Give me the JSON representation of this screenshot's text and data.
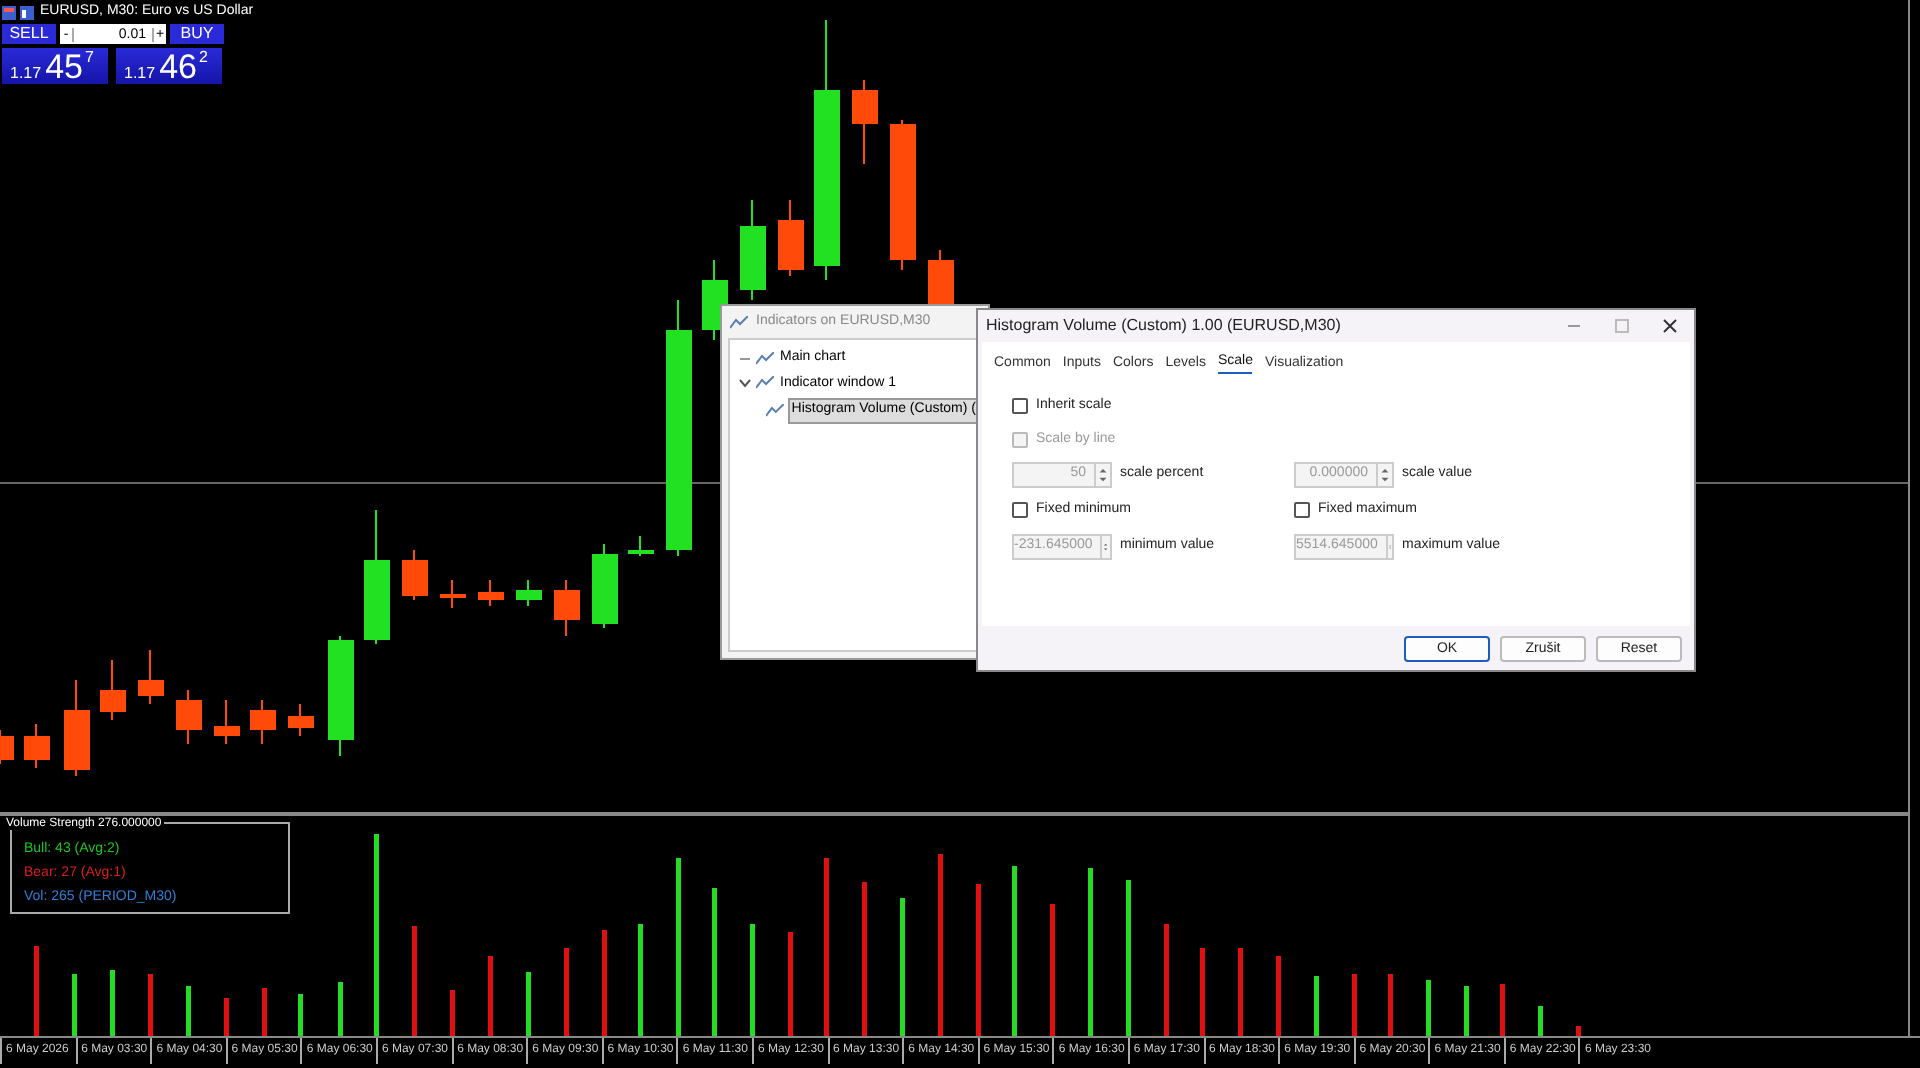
{
  "chart_title": "EURUSD, M30:  Euro vs US Dollar",
  "trade_panel": {
    "sell": "SELL",
    "buy": "BUY",
    "lot": "0.01",
    "minus": "-",
    "plus": "+",
    "bid": {
      "prefix": "1.17",
      "pips": "45",
      "point": "7"
    },
    "ask": {
      "prefix": "1.17",
      "pips": "46",
      "point": "2"
    }
  },
  "indicator_box": {
    "title": "Volume Strength 276.000000",
    "lines": [
      {
        "text": "Bull: 43 (Avg:2)",
        "color": "#19c819"
      },
      {
        "text": "Bear: 27 (Avg:1)",
        "color": "#d81e1e"
      },
      {
        "text": "Vol: 265 (PERIOD_M30)",
        "color": "#2f7fd8"
      }
    ]
  },
  "time_axis": [
    "6 May 2026",
    "6 May 03:30",
    "6 May 04:30",
    "6 May 05:30",
    "6 May 06:30",
    "6 May 07:30",
    "6 May 08:30",
    "6 May 09:30",
    "6 May 10:30",
    "6 May 11:30",
    "6 May 12:30",
    "6 May 13:30",
    "6 May 14:30",
    "6 May 15:30",
    "6 May 16:30",
    "6 May 17:30",
    "6 May 18:30",
    "6 May 19:30",
    "6 May 20:30",
    "6 May 21:30",
    "6 May 22:30",
    "6 May 23:30"
  ],
  "indicators_window": {
    "title": "Indicators on EURUSD,M30",
    "tree": [
      {
        "label": "Main chart",
        "selected": false,
        "expanded": false
      },
      {
        "label": "Indicator window 1",
        "selected": false,
        "expanded": true,
        "children": [
          {
            "label": "Histogram Volume (Custom) (",
            "selected": true
          }
        ]
      }
    ]
  },
  "dialog": {
    "title": "Histogram Volume (Custom) 1.00 (EURUSD,M30)",
    "tabs": [
      {
        "label": "Common",
        "selected": false
      },
      {
        "label": "Inputs",
        "selected": false
      },
      {
        "label": "Colors",
        "selected": false
      },
      {
        "label": "Levels",
        "selected": false
      },
      {
        "label": "Scale",
        "selected": true
      },
      {
        "label": "Visualization",
        "selected": false
      }
    ],
    "inherit_scale": {
      "label": "Inherit scale",
      "checked": false,
      "disabled": false
    },
    "scale_by_line": {
      "label": "Scale by line",
      "checked": false,
      "disabled": true
    },
    "scale_percent": {
      "value": "50",
      "label": "scale percent",
      "disabled": true
    },
    "scale_value": {
      "value": "0.000000",
      "label": "scale value",
      "disabled": true
    },
    "fixed_minimum": {
      "label": "Fixed minimum",
      "checked": false,
      "disabled": false
    },
    "fixed_maximum": {
      "label": "Fixed maximum",
      "checked": false,
      "disabled": false
    },
    "minimum_value": {
      "value": "-231.645000",
      "label": "minimum value",
      "disabled": true
    },
    "maximum_value": {
      "value": "5514.645000",
      "label": "maximum value",
      "disabled": true
    },
    "buttons": [
      {
        "label": "OK",
        "default": true
      },
      {
        "label": "Zrušit",
        "default": false
      },
      {
        "label": "Reset",
        "default": false
      }
    ]
  }
}
